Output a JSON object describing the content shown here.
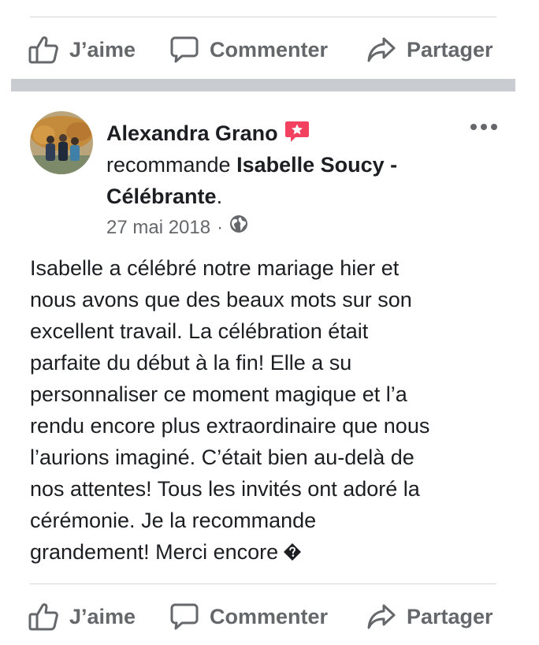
{
  "top_actions": {
    "like_label": "J’aime",
    "comment_label": "Commenter",
    "share_label": "Partager"
  },
  "post": {
    "author": "Alexandra Grano",
    "recommends_text": "recommande",
    "page_name_part1": "Isabelle Soucy -",
    "page_name_part2": "Célébrante",
    "page_name_suffix": ".",
    "date": "27 mai 2018",
    "separator": "·",
    "body_lines": [
      "Isabelle a célébré notre mariage hier et",
      "nous avons que des beaux mots sur son",
      "excellent travail. La célébration était",
      "parfaite du début à la fin! Elle a su",
      "personnaliser ce moment magique et l’a",
      "rendu encore plus extraordinaire que nous",
      "l’aurions imaginé. C’était bien au-delà de",
      "nos attentes! Tous les invités ont adoré la",
      "cérémonie. Je la recommande",
      "grandement! Merci encore"
    ]
  },
  "bottom_actions": {
    "like_label": "J’aime",
    "comment_label": "Commenter",
    "share_label": "Partager"
  },
  "icons": {
    "like": "thumbs-up-icon",
    "comment": "comment-bubble-icon",
    "share": "share-arrow-icon",
    "recommendation_badge": "star-badge-icon",
    "privacy": "globe-icon",
    "more": "more-options-icon",
    "unknown_emoji": "unknown-character-icon"
  },
  "colors": {
    "secondary_text": "#65676b",
    "primary_text": "#1c1e21",
    "badge_pink": "#f3425f",
    "separator_gray": "#c9ccd1"
  }
}
